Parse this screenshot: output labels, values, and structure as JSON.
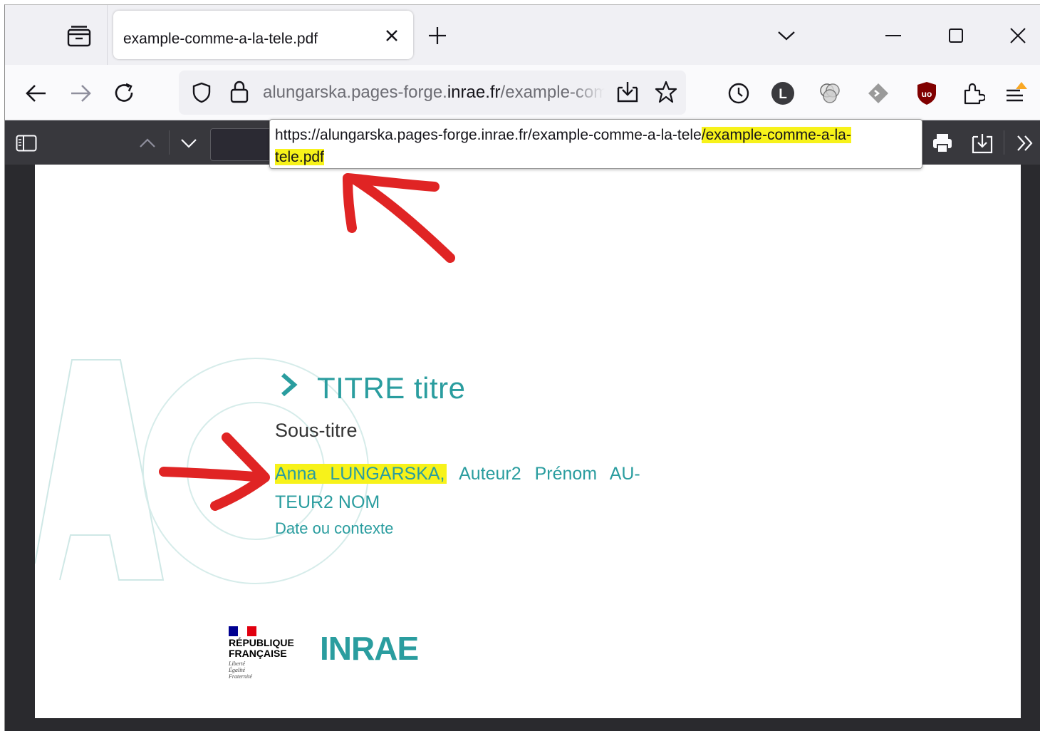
{
  "browser": {
    "tab": {
      "title": "example-comme-a-la-tele.pdf"
    },
    "url": {
      "prefix": "alungarska.pages-forge.",
      "host": "inrae.fr",
      "suffix": "/example-comme-a-la-tele/example-comme-a-la-tele.pdf"
    },
    "tooltip": {
      "normal": "https://alungarska.pages-forge.inrae.fr/example-comme-a-la-tele",
      "highlighted_1": "/example-comme-a-la-",
      "highlighted_2": "tele.pdf"
    }
  },
  "pdf_toolbar": {
    "page_value": ""
  },
  "document": {
    "title": "TITRE titre",
    "subtitle": "Sous-titre",
    "author_highlighted": "Anna LUNGARSKA,",
    "authors_rest": "Auteur2 Prénom AU-",
    "authors_line2": "TEUR2 NOM",
    "date": "Date ou contexte",
    "logos": {
      "republique": "RÉPUBLIQUE FRANÇAISE",
      "motto": "Liberté Égalité Fraternité",
      "inrae": "INRAE"
    }
  },
  "colors": {
    "teal": "#2a9d9f",
    "highlight": "#f7f21a",
    "annotation_red": "#e02424",
    "toolbar": "#38383d"
  },
  "icons": [
    "tab-list-icon",
    "close-icon",
    "plus-icon",
    "chevron-down-icon",
    "minimize-icon",
    "maximize-icon",
    "back-icon",
    "forward-icon",
    "reload-icon",
    "shield-icon",
    "lock-icon",
    "download-icon",
    "star-icon",
    "history-icon",
    "extension-l-icon",
    "extension-circles-icon",
    "extension-diamond-icon",
    "ublock-icon",
    "extensions-icon",
    "menu-icon",
    "sidebar-toggle-icon",
    "page-up-icon",
    "page-down-icon",
    "print-icon",
    "save-icon",
    "more-tools-icon"
  ]
}
